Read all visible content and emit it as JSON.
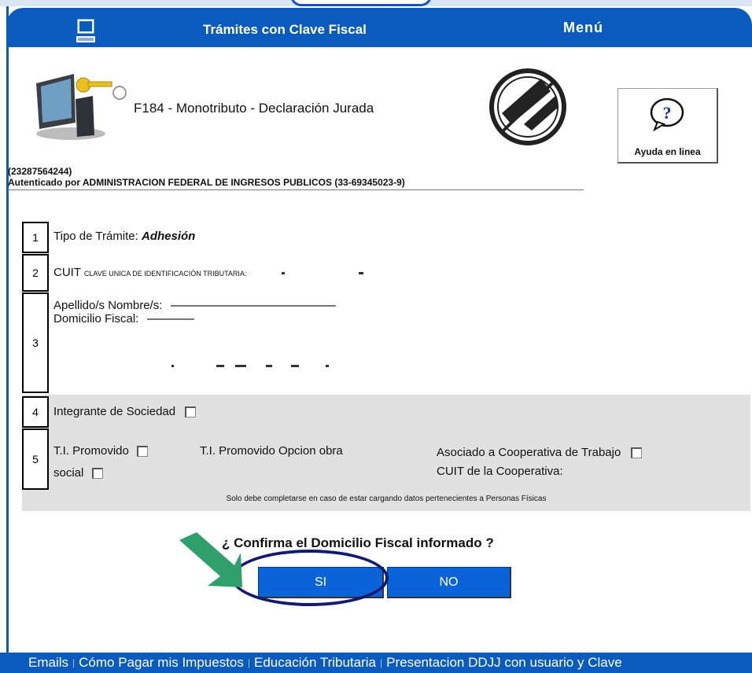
{
  "header": {
    "title": "Trámites con Clave Fiscal",
    "menu": "Menú"
  },
  "form": {
    "title": "F184 - Monotributo - Declaración Jurada",
    "help_label": "Ayuda en linea",
    "user_cuit": "(23287564244)",
    "authenticated": "Autenticado por ADMINISTRACION FEDERAL DE INGRESOS PUBLICOS (33-69345023-9)"
  },
  "sections": {
    "s1": {
      "num": "1",
      "label": "Tipo de Trámite:",
      "value": "Adhesión"
    },
    "s2": {
      "num": "2",
      "label": "CUIT",
      "sublabel": "CLAVE UNICA DE IDENTIFICACIÓN TRIBUTARIA:"
    },
    "s3": {
      "num": "3",
      "name_label": "Apellido/s Nombre/s:",
      "address_label": "Domicilio Fiscal:"
    },
    "s4": {
      "num": "4",
      "label": "Integrante de Sociedad",
      "checked": false
    },
    "s5": {
      "num": "5",
      "ti_promovido": "T.I. Promovido",
      "ti_obra_a": "T.I. Promovido Opcion obra",
      "ti_obra_b": "social",
      "coop": "Asociado a Cooperativa de Trabajo",
      "coop_cuit": "CUIT de la Cooperativa:"
    },
    "note": "Solo debe completarse en caso de estar cargando datos pertenecientes a Personas Físicas"
  },
  "confirm": {
    "question": "¿ Confirma el Domicilio Fiscal informado ?",
    "yes": "SI",
    "no": "NO"
  },
  "footer": {
    "links": [
      "Emails",
      "Cómo Pagar mis Impuestos",
      "Educación Tributaria",
      "Presentacion DDJJ con usuario y Clave"
    ]
  },
  "colors": {
    "brand_blue": "#0a5bbd",
    "button_blue": "#0b63d9",
    "panel_gray": "#e1e1e1",
    "annotation_green": "#2fa06a",
    "annotation_navy": "#131a72"
  }
}
